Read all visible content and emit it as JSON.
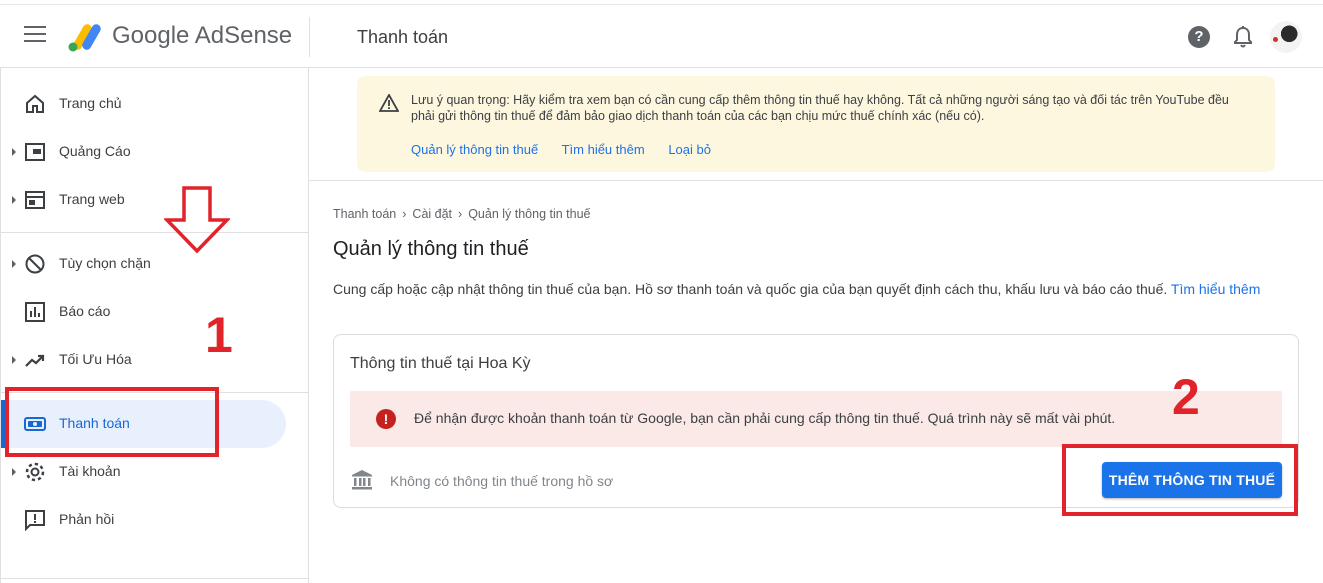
{
  "header": {
    "app_name": "Google AdSense",
    "page_title": "Thanh toán",
    "help_glyph": "?",
    "icons": [
      "menu-icon",
      "adsense-logo",
      "help-icon",
      "bell-icon",
      "avatar"
    ]
  },
  "sidebar": {
    "items": [
      {
        "label": "Trang chủ",
        "icon": "home-icon"
      },
      {
        "label": "Quảng Cáo",
        "icon": "ads-icon"
      },
      {
        "label": "Trang web",
        "icon": "sites-icon"
      },
      {
        "label": "Tùy chọn chặn",
        "icon": "block-icon"
      },
      {
        "label": "Báo cáo",
        "icon": "reports-icon"
      },
      {
        "label": "Tối Ưu Hóa",
        "icon": "optimization-icon"
      },
      {
        "label": "Thanh toán",
        "icon": "payments-icon",
        "active": true
      },
      {
        "label": "Tài khoản",
        "icon": "account-gear-icon"
      },
      {
        "label": "Phản hồi",
        "icon": "feedback-icon"
      }
    ]
  },
  "banner": {
    "message": "Lưu ý quan trọng: Hãy kiểm tra xem bạn có cần cung cấp thêm thông tin thuế hay không. Tất cả những người sáng tạo và đối tác trên YouTube đều phải gửi thông tin thuế để đảm bảo giao dịch thanh toán của các bạn chịu mức thuế chính xác (nếu có).",
    "links": [
      "Quản lý thông tin thuế",
      "Tìm hiểu thêm",
      "Loại bỏ"
    ]
  },
  "breadcrumb": [
    "Thanh toán",
    "Cài đặt",
    "Quản lý thông tin thuế"
  ],
  "breadcrumb_sep": "›",
  "main": {
    "heading": "Quản lý thông tin thuế",
    "description": "Cung cấp hoặc cập nhật thông tin thuế của bạn. Hồ sơ thanh toán và quốc gia của bạn quyết định cách thu, khấu lưu và báo cáo thuế.",
    "description_link": "Tìm hiểu thêm"
  },
  "card": {
    "title": "Thông tin thuế tại Hoa Kỳ",
    "error_glyph": "!",
    "error_message": "Để nhận được khoản thanh toán từ Google, bạn cần phải cung cấp thông tin thuế. Quá trình này sẽ mất vài phút.",
    "empty_text": "Không có thông tin thuế trong hồ sơ",
    "button_label": "THÊM THÔNG TIN THUẾ"
  },
  "annotations": {
    "step1": "1",
    "step2": "2",
    "color": "#e0242a"
  },
  "colors": {
    "accent": "#1a73e8",
    "active_bg": "#e8f0fe",
    "banner_bg": "#fef7e0",
    "error_bg": "#fbe9e7",
    "error_icon": "#c5221f"
  }
}
